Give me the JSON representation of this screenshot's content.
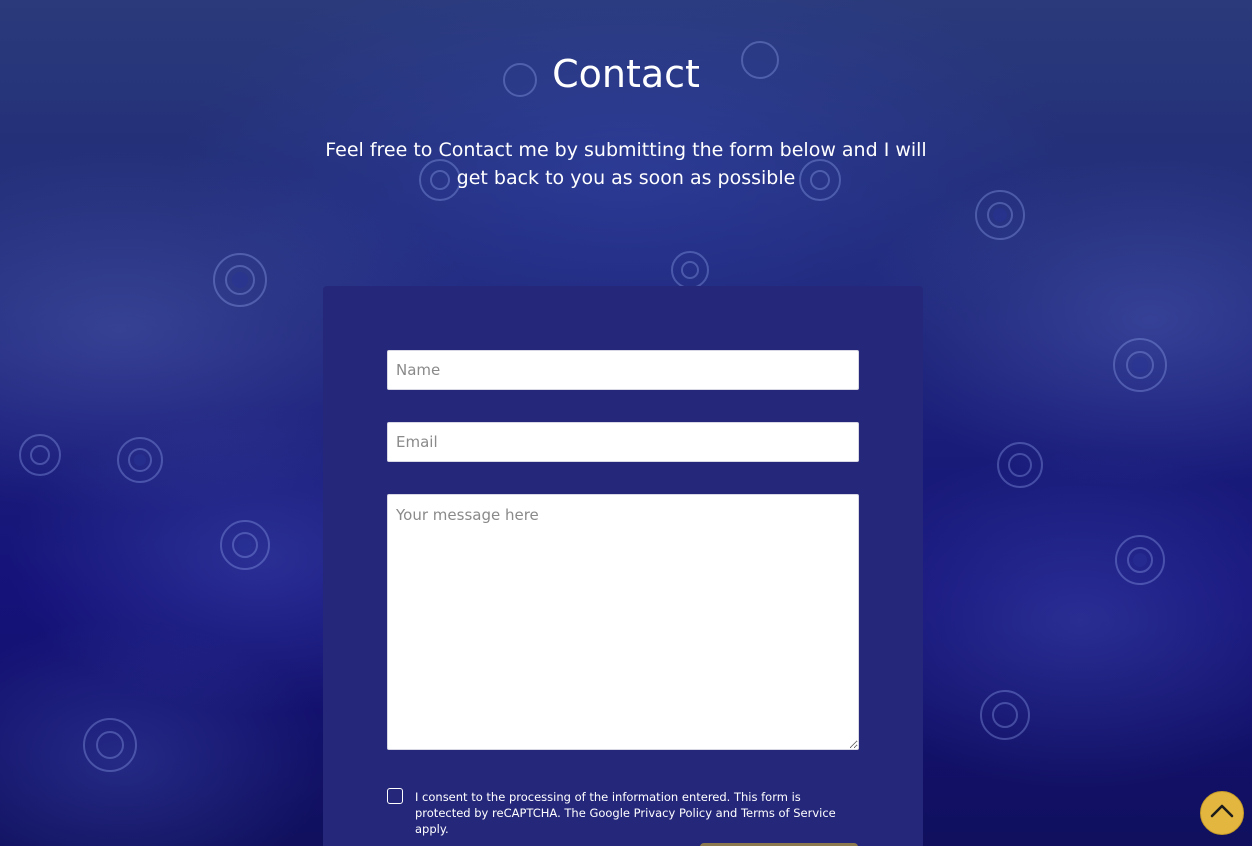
{
  "page": {
    "title": "Contact",
    "subtitle": "Feel free to Contact me by submitting the form below and I will get back to you as soon as possible"
  },
  "form": {
    "name_placeholder": "Name",
    "email_placeholder": "Email",
    "message_placeholder": "Your message here",
    "consent_text": "I consent to the processing of the information entered. This form is protected by reCAPTCHA. The Google Privacy Policy and Terms of Service apply.",
    "consent_checked": false
  },
  "icons": {
    "scroll_top": "chevron-up-icon",
    "background": "fractal-background"
  },
  "colors": {
    "card": "#25277b",
    "scroll_top_button": "#e3b640",
    "submit_button": "#8c7a4e"
  }
}
